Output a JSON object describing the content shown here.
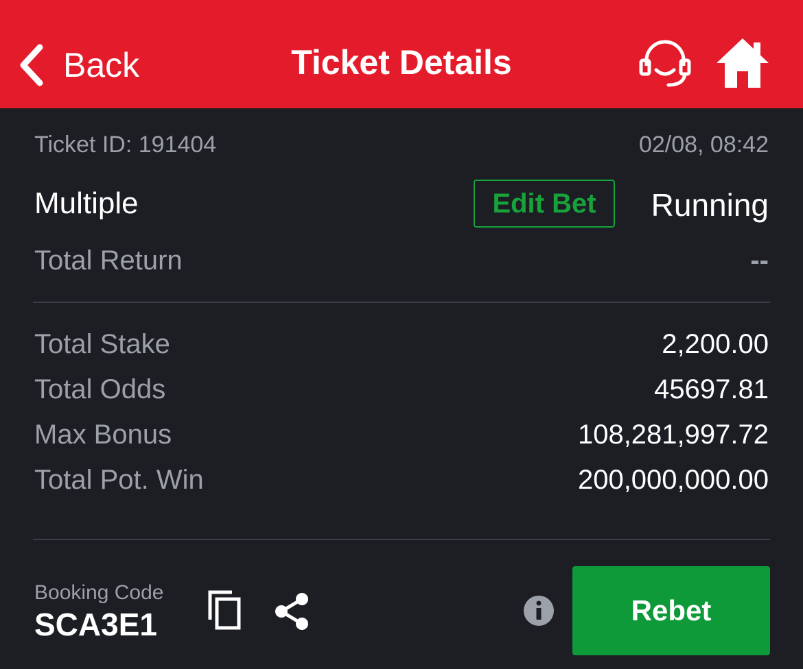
{
  "header": {
    "back_label": "Back",
    "title": "Ticket Details",
    "support_icon": "headset-icon",
    "home_icon": "home-icon",
    "background_color": "#e41b2a"
  },
  "ticket": {
    "id_label": "Ticket ID: 191404",
    "datetime": "02/08, 08:42",
    "bet_type": "Multiple",
    "edit_label": "Edit Bet",
    "status": "Running",
    "total_return_label": "Total Return",
    "total_return_value": "--"
  },
  "summary": [
    {
      "label": "Total Stake",
      "value": "2,200.00"
    },
    {
      "label": "Total Odds",
      "value": "45697.81"
    },
    {
      "label": "Max Bonus",
      "value": "108,281,997.72"
    },
    {
      "label": "Total Pot. Win",
      "value": "200,000,000.00"
    }
  ],
  "footer": {
    "booking_label": "Booking Code",
    "booking_code": "SCA3E1",
    "copy_icon": "copy-icon",
    "share_icon": "share-icon",
    "info_icon": "info-icon",
    "rebet_label": "Rebet",
    "rebet_color": "#0f9a3a"
  }
}
